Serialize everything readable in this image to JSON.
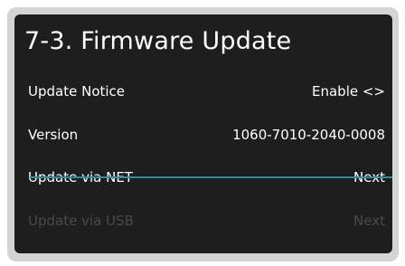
{
  "screen": {
    "title": "7-3.  Firmware Update"
  },
  "menu": {
    "items": [
      {
        "label": "Update Notice",
        "value": "Enable <>",
        "enabled": true
      },
      {
        "label": "Version",
        "value": "1060-7010-2040-0008",
        "enabled": true
      },
      {
        "label": "Update via NET",
        "value": "Next",
        "enabled": true,
        "selected": true
      },
      {
        "label": "Update via USB",
        "value": "Next",
        "enabled": false
      }
    ]
  },
  "colors": {
    "panel_background": "#1e1e1e",
    "frame": "#d4d4d4",
    "text": "#ffffff",
    "disabled_text": "#4a4a4a",
    "cursor_accent": "#2a8fa8"
  }
}
